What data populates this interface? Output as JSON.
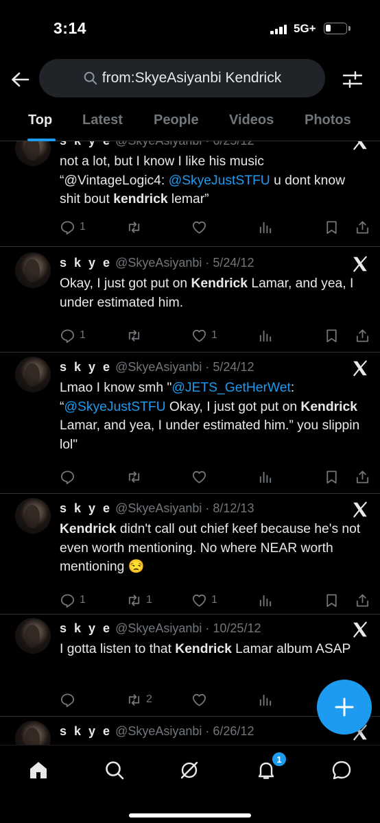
{
  "status_bar": {
    "time": "3:14",
    "network": "5G+",
    "battery_level": 0.25
  },
  "header": {
    "search_query": "from:SkyeAsiyanbi Kendrick"
  },
  "tabs": [
    {
      "label": "Top",
      "active": true
    },
    {
      "label": "Latest"
    },
    {
      "label": "People"
    },
    {
      "label": "Videos"
    },
    {
      "label": "Photos"
    }
  ],
  "tweets": [
    {
      "name": "s k y e",
      "handle": "@SkyeAsiyanbi",
      "date": "· 6/25/12",
      "text_parts": [
        {
          "t": "not a lot, but I know I like his music “@VintageLogic4: "
        },
        {
          "t": "@SkyeJustSTFU",
          "k": "mention"
        },
        {
          "t": " u dont know shit bout "
        },
        {
          "t": "kendrick",
          "k": "hl"
        },
        {
          "t": " lemar”"
        }
      ],
      "replies": "1",
      "reposts": "",
      "likes": ""
    },
    {
      "name": "s k y e",
      "handle": "@SkyeAsiyanbi",
      "date": "· 5/24/12",
      "text_parts": [
        {
          "t": "Okay, I just got put on "
        },
        {
          "t": "Kendrick",
          "k": "hl"
        },
        {
          "t": " Lamar, and yea, I under estimated him."
        }
      ],
      "replies": "1",
      "reposts": "",
      "likes": "1"
    },
    {
      "name": "s k y e",
      "handle": "@SkyeAsiyanbi",
      "date": "· 5/24/12",
      "text_parts": [
        {
          "t": "Lmao I know smh \""
        },
        {
          "t": "@JETS_GetHerWet",
          "k": "mention"
        },
        {
          "t": ": “"
        },
        {
          "t": "@SkyeJustSTFU",
          "k": "mention"
        },
        {
          "t": " Okay, I just got put on "
        },
        {
          "t": "Kendrick",
          "k": "hl"
        },
        {
          "t": " Lamar, and yea, I under estimated him.” you slippin lol\""
        }
      ],
      "replies": "",
      "reposts": "",
      "likes": ""
    },
    {
      "name": "s k y e",
      "handle": "@SkyeAsiyanbi",
      "date": "· 8/12/13",
      "text_parts": [
        {
          "t": "Kendrick",
          "k": "hl"
        },
        {
          "t": " didn't call out chief keef because he's not even worth mentioning. No where NEAR worth mentioning 😒"
        }
      ],
      "replies": "1",
      "reposts": "1",
      "likes": "1"
    },
    {
      "name": "s k y e",
      "handle": "@SkyeAsiyanbi",
      "date": "· 10/25/12",
      "text_parts": [
        {
          "t": "I gotta listen to that "
        },
        {
          "t": "Kendrick",
          "k": "hl"
        },
        {
          "t": " Lamar album ASAP"
        }
      ],
      "replies": "",
      "reposts": "2",
      "likes": ""
    },
    {
      "name": "s k y e",
      "handle": "@SkyeAsiyanbi",
      "date": "· 6/26/12",
      "text_parts": [],
      "replies": "",
      "reposts": "",
      "likes": ""
    }
  ],
  "bottom_nav": {
    "items": [
      "home-icon",
      "search-icon",
      "grok-icon",
      "notifications-icon",
      "messages-icon"
    ],
    "notification_badge": "1"
  },
  "colors": {
    "accent": "#1d9bf0",
    "muted": "#71767b",
    "background": "#000000"
  }
}
